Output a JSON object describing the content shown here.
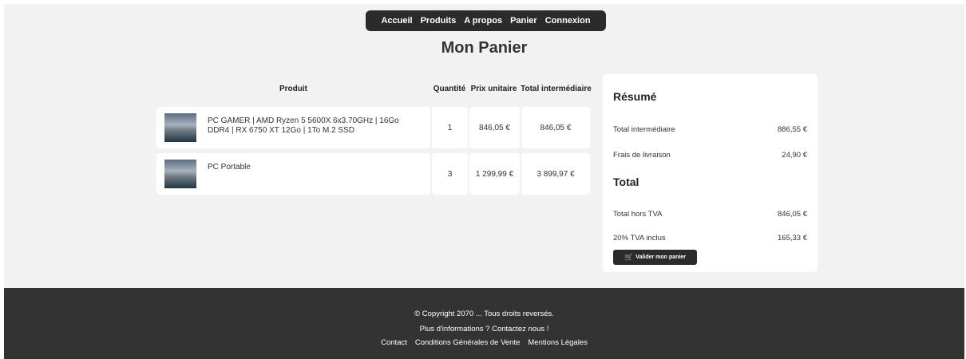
{
  "nav": {
    "items": [
      "Accueil",
      "Produits",
      "A propos",
      "Panier",
      "Connexion"
    ]
  },
  "page_title": "Mon Panier",
  "table": {
    "headers": {
      "product": "Produit",
      "quantity": "Quantité",
      "unit_price": "Prix unitaire",
      "subtotal": "Total intermédiaire"
    },
    "rows": [
      {
        "name": "PC GAMER | AMD Ryzen 5 5600X 6x3.70GHz | 16Go DDR4 | RX 6750 XT 12Go | 1To M.2 SSD",
        "quantity": "1",
        "unit_price": "846,05 €",
        "subtotal": "846,05 €"
      },
      {
        "name": "PC Portable",
        "quantity": "3",
        "unit_price": "1 299,99 €",
        "subtotal": "3 899,97 €"
      }
    ]
  },
  "summary": {
    "title": "Résumé",
    "subtotal_label": "Total intermédiaire",
    "subtotal_value": "886,55 €",
    "shipping_label": "Frais de livraison",
    "shipping_value": "24,90 €",
    "total_title": "Total",
    "total_ht_label": "Total hors TVA",
    "total_ht_value": "846,05 €",
    "tva_label": "20% TVA inclus",
    "tva_value": "165,33 €",
    "validate_label": "Valider mon panier",
    "validate_icon": "cart-icon"
  },
  "footer": {
    "copyright": "© Copyright 2070 ... Tous droits reversés.",
    "contact_prompt": "Plus d'informations ? Contactez nous !",
    "links": [
      "Contact",
      "Conditions Générales de Vente",
      "Mentions Légales"
    ]
  },
  "colors": {
    "nav_bg": "#2b2b2b",
    "page_bg": "#f2f2f2",
    "footer_bg": "#333333",
    "card_bg": "#ffffff"
  }
}
